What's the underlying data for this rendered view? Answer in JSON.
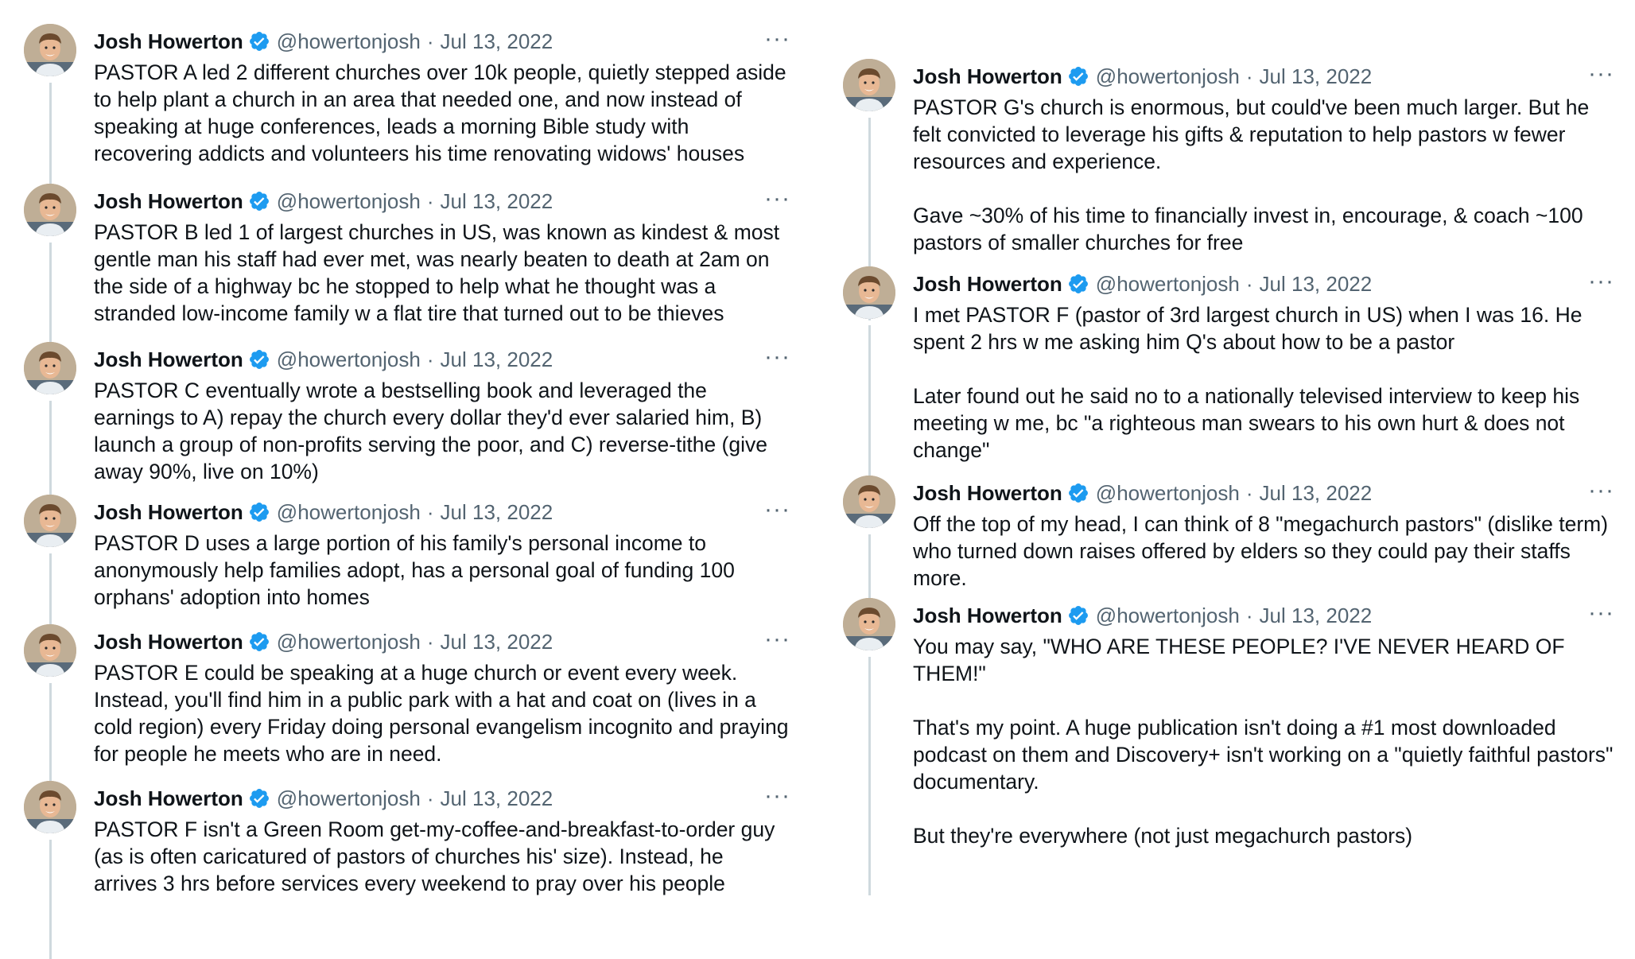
{
  "colors": {
    "verified_badge": "#1d9bf0",
    "handle_gray": "#536471",
    "thread_line": "#cfd9de",
    "text": "#0f1419"
  },
  "icons": {
    "verified": "verified-badge-icon",
    "more": "more-options-icon",
    "avatar": "avatar-photo"
  },
  "left_column": [
    {
      "name": "Josh Howerton",
      "handle": "@howertonjosh",
      "separator": "·",
      "date": "Jul 13, 2022",
      "more": "···",
      "paragraphs": [
        "PASTOR A led 2 different churches over 10k people, quietly stepped aside to help plant a church in an area that needed one, and now instead of speaking at huge conferences, leads a morning Bible study with recovering addicts and volunteers his time renovating widows' houses"
      ]
    },
    {
      "name": "Josh Howerton",
      "handle": "@howertonjosh",
      "separator": "·",
      "date": "Jul 13, 2022",
      "more": "···",
      "paragraphs": [
        "PASTOR B led 1 of largest churches in US, was known as kindest & most gentle man his staff had ever met, was nearly beaten to death at 2am on the side of a highway bc he stopped to help what he thought was a stranded low-income family w a flat tire that turned out to be thieves"
      ]
    },
    {
      "name": "Josh Howerton",
      "handle": "@howertonjosh",
      "separator": "·",
      "date": "Jul 13, 2022",
      "more": "···",
      "paragraphs": [
        "PASTOR C eventually wrote a bestselling book and leveraged the earnings to A) repay the church every dollar they'd ever salaried him, B) launch a group of non-profits serving the poor, and C) reverse-tithe (give away 90%, live on 10%)"
      ]
    },
    {
      "name": "Josh Howerton",
      "handle": "@howertonjosh",
      "separator": "·",
      "date": "Jul 13, 2022",
      "more": "···",
      "paragraphs": [
        "PASTOR D uses a large portion of his family's personal income to anonymously help families adopt, has a personal goal of funding 100 orphans' adoption into homes"
      ]
    },
    {
      "name": "Josh Howerton",
      "handle": "@howertonjosh",
      "separator": "·",
      "date": "Jul 13, 2022",
      "more": "···",
      "paragraphs": [
        "PASTOR E could be speaking at a huge church or event every week. Instead, you'll find him in a public park with a hat and coat on (lives in a cold region) every Friday doing personal evangelism incognito and praying for people he meets who are in need."
      ]
    },
    {
      "name": "Josh Howerton",
      "handle": "@howertonjosh",
      "separator": "·",
      "date": "Jul 13, 2022",
      "more": "···",
      "paragraphs": [
        "PASTOR F isn't a Green Room get-my-coffee-and-breakfast-to-order guy (as is often caricatured of pastors of churches his' size). Instead, he arrives 3 hrs before services every weekend to pray over his people"
      ]
    }
  ],
  "right_column": [
    {
      "name": "Josh Howerton",
      "handle": "@howertonjosh",
      "separator": "·",
      "date": "Jul 13, 2022",
      "more": "···",
      "paragraphs": [
        "PASTOR G's church is enormous, but could've been much larger. But he felt convicted to leverage his gifts & reputation to help pastors w fewer resources and experience.",
        "Gave ~30% of his time to financially invest in, encourage, & coach ~100 pastors of smaller churches for free"
      ]
    },
    {
      "name": "Josh Howerton",
      "handle": "@howertonjosh",
      "separator": "·",
      "date": "Jul 13, 2022",
      "more": "···",
      "paragraphs": [
        "I met PASTOR F (pastor of 3rd largest church in US) when I was 16. He spent 2 hrs w me asking him Q's about how to be a pastor",
        "Later found out he said no to a nationally televised interview to keep his meeting w me, bc \"a righteous man swears to his own hurt & does not change\""
      ]
    },
    {
      "name": "Josh Howerton",
      "handle": "@howertonjosh",
      "separator": "·",
      "date": "Jul 13, 2022",
      "more": "···",
      "paragraphs": [
        "Off the top of my head, I can think of 8 \"megachurch pastors\" (dislike term) who turned down raises offered by elders so they could pay their staffs more."
      ]
    },
    {
      "name": "Josh Howerton",
      "handle": "@howertonjosh",
      "separator": "·",
      "date": "Jul 13, 2022",
      "more": "···",
      "paragraphs": [
        "You may say, \"WHO ARE THESE PEOPLE? I'VE NEVER HEARD OF THEM!\"",
        "That's my point. A huge publication isn't doing a #1 most downloaded podcast on them and Discovery+ isn't working on a \"quietly faithful pastors\" documentary.",
        "But they're everywhere (not just megachurch pastors)"
      ]
    }
  ]
}
